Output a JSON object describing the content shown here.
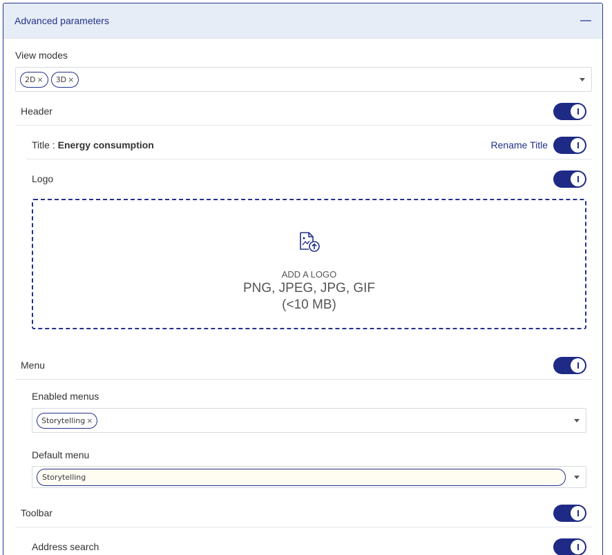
{
  "panel": {
    "title": "Advanced parameters"
  },
  "view_modes": {
    "label": "View modes",
    "chips": [
      "2D",
      "3D"
    ]
  },
  "header_section": {
    "label": "Header",
    "toggle_on": true
  },
  "title_row": {
    "prefix": "Title : ",
    "value": "Energy consumption",
    "rename_label": "Rename Title",
    "toggle_on": true
  },
  "logo_row": {
    "label": "Logo",
    "toggle_on": true
  },
  "dropzone": {
    "add_label": "ADD A LOGO",
    "formats": "PNG, JPEG, JPG, GIF",
    "size_limit": "(<10 MB)",
    "icon": "image-upload-icon"
  },
  "menu_section": {
    "label": "Menu",
    "toggle_on": true
  },
  "enabled_menus": {
    "label": "Enabled menus",
    "chips": [
      "Storytelling"
    ]
  },
  "default_menu": {
    "label": "Default menu",
    "value": "Storytelling"
  },
  "toolbar_section": {
    "label": "Toolbar",
    "toggle_on": true
  },
  "address_search": {
    "label": "Address search",
    "toggle_on": true
  },
  "colors": {
    "accent": "#1e2a85",
    "header_bg": "#e6edf6",
    "border": "#d6d9e0"
  },
  "chip_remove_glyph": "×"
}
